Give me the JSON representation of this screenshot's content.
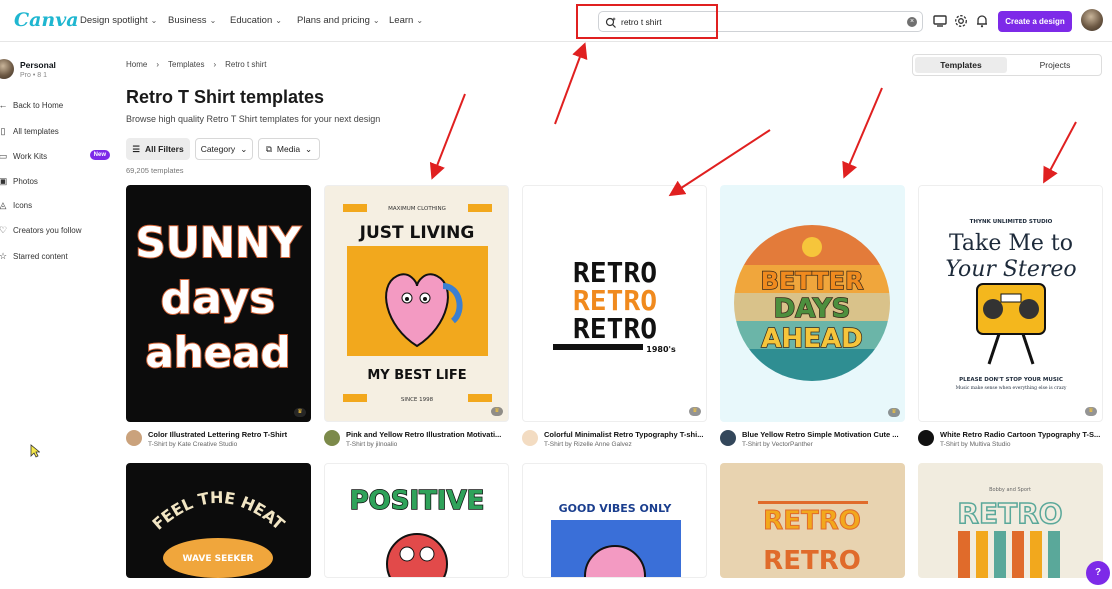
{
  "brand": {
    "logo": "Canva",
    "accent": "#7d2ae8",
    "logo_color": "#1fb6d0"
  },
  "topnav": {
    "items": [
      "Design spotlight",
      "Business",
      "Education",
      "Plans and pricing",
      "Learn"
    ],
    "search_value": "retro t shirt",
    "create_label": "Create a design"
  },
  "sidebar": {
    "account_name": "Personal",
    "account_sub": "Pro • 8 1",
    "items": [
      {
        "label": "Back to Home",
        "icon": "arrow-left-icon"
      },
      {
        "label": "All templates",
        "icon": "template-icon"
      },
      {
        "label": "Work Kits",
        "icon": "work-kits-icon",
        "badge": "New"
      },
      {
        "label": "Photos",
        "icon": "photo-icon"
      },
      {
        "label": "Icons",
        "icon": "shapes-icon"
      },
      {
        "label": "Creators you follow",
        "icon": "heart-icon"
      },
      {
        "label": "Starred content",
        "icon": "star-icon"
      }
    ]
  },
  "breadcrumb": [
    "Home",
    "Templates",
    "Retro t shirt"
  ],
  "view_toggle": {
    "active": "Templates",
    "inactive": "Projects"
  },
  "page": {
    "title": "Retro T Shirt templates",
    "subtitle": "Browse high quality Retro T Shirt templates for your next design",
    "count": "69,205 templates"
  },
  "filters": {
    "all": "All Filters",
    "category": "Category",
    "media": "Media"
  },
  "cards_row1": [
    {
      "title": "Color Illustrated Lettering Retro T-Shirt",
      "author": "T-Shirt by Kate Creative Studio",
      "art": [
        "SUNNY",
        "days",
        "ahead"
      ]
    },
    {
      "title": "Pink and Yellow Retro Illustration Motivati...",
      "author": "T-Shirt by jilnoalio",
      "art": [
        "JUST LIVING",
        "MY BEST LIFE",
        "MAXIMUM CLOTHING",
        "SINCE 1998"
      ]
    },
    {
      "title": "Colorful Minimalist Retro Typography T-shi...",
      "author": "T-Shirt by Rizelle Anne Galvez",
      "art": [
        "RETRO",
        "RETRO",
        "RETRO",
        "1980's"
      ]
    },
    {
      "title": "Blue Yellow Retro Simple Motivation Cute ...",
      "author": "T-Shirt by VectorPanther",
      "art": [
        "BETTER",
        "DAYS",
        "AHEAD"
      ]
    },
    {
      "title": "White Retro Radio Cartoon Typography T-S...",
      "author": "T-Shirt by Multiva Studio",
      "art": [
        "THYNK UNLIMITED STUDIO",
        "Take Me to",
        "Your Stereo",
        "PLEASE DON'T STOP YOUR MUSIC",
        "Music make sense when everything else is crazy"
      ]
    }
  ],
  "cards_row2": [
    {
      "art": [
        "FEEL THE HEAT",
        "WAVE SEEKER"
      ]
    },
    {
      "art": [
        "POSITIVE"
      ]
    },
    {
      "art": [
        "GOOD VIBES ONLY"
      ]
    },
    {
      "art": [
        "RETRO",
        "RETRO"
      ]
    },
    {
      "art": [
        "Bobby and Sport",
        "RETRO"
      ]
    }
  ],
  "help_label": "?"
}
